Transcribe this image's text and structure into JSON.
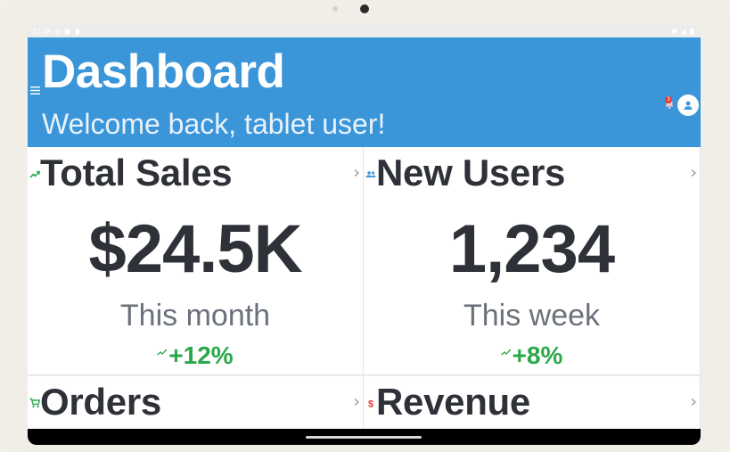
{
  "status": {
    "time": "12:48"
  },
  "appbar": {
    "title": "Dashboard",
    "subtitle": "Welcome back, tablet user!",
    "notification_count": "3",
    "color": "#3a95d9"
  },
  "cards": [
    {
      "title": "Total Sales",
      "icon": "trending-up-icon",
      "value": "$24.5K",
      "period": "This month",
      "change": "+12%"
    },
    {
      "title": "New Users",
      "icon": "people-icon",
      "value": "1,234",
      "period": "This week",
      "change": "+8%"
    },
    {
      "title": "Orders",
      "icon": "cart-icon"
    },
    {
      "title": "Revenue",
      "icon": "dollar-icon"
    }
  ],
  "colors": {
    "positive": "#2aa84a",
    "text": "#2f3138",
    "muted": "#6b717b"
  }
}
